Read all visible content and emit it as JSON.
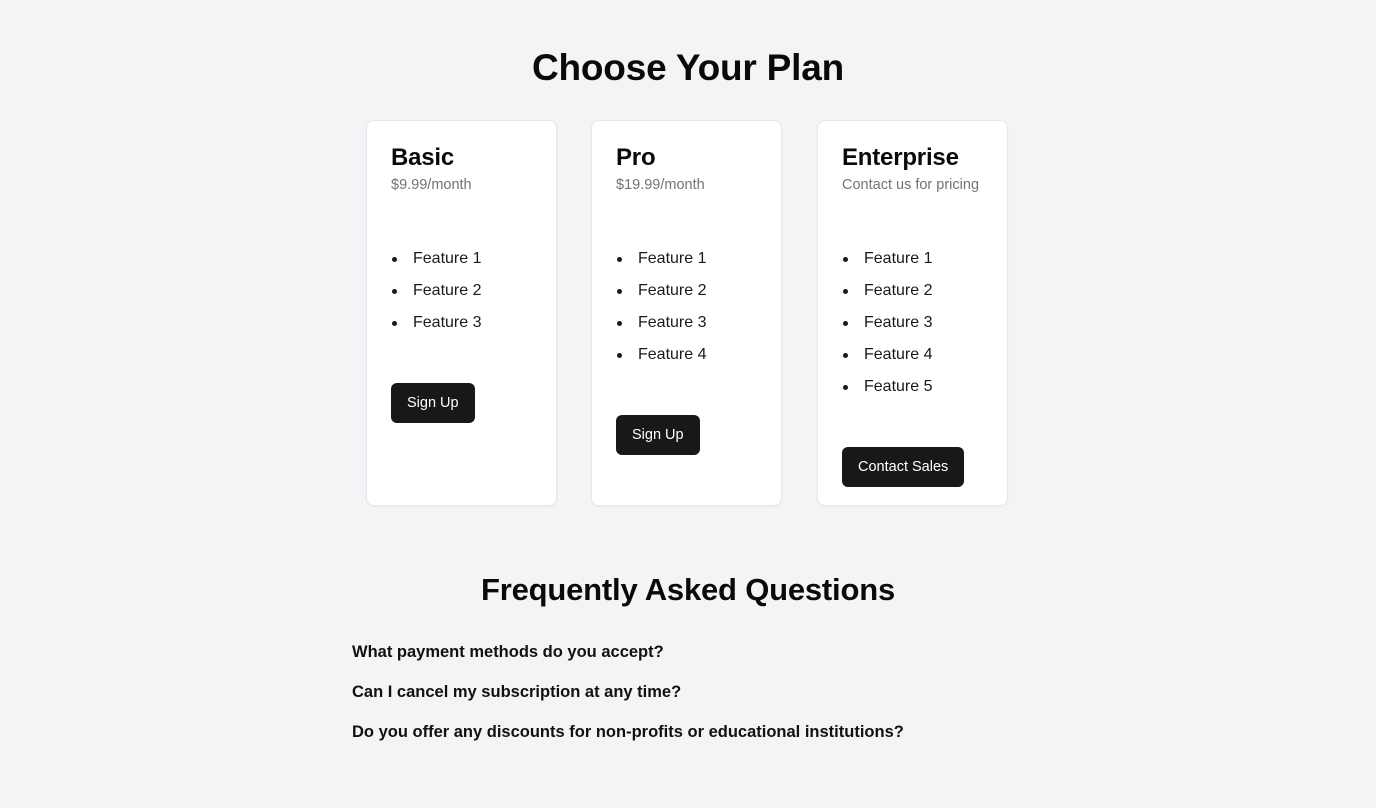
{
  "page": {
    "title": "Choose Your Plan"
  },
  "plans": [
    {
      "name": "Basic",
      "price": "$9.99/month",
      "features": [
        "Feature 1",
        "Feature 2",
        "Feature 3"
      ],
      "cta_label": "Sign Up"
    },
    {
      "name": "Pro",
      "price": "$19.99/month",
      "features": [
        "Feature 1",
        "Feature 2",
        "Feature 3",
        "Feature 4"
      ],
      "cta_label": "Sign Up"
    },
    {
      "name": "Enterprise",
      "price": "Contact us for pricing",
      "features": [
        "Feature 1",
        "Feature 2",
        "Feature 3",
        "Feature 4",
        "Feature 5"
      ],
      "cta_label": "Contact Sales"
    }
  ],
  "faq": {
    "title": "Frequently Asked Questions",
    "questions": [
      "What payment methods do you accept?",
      "Can I cancel my subscription at any time?",
      "Do you offer any discounts for non-profits or educational institutions?"
    ]
  },
  "colors": {
    "background": "#f3f4f6",
    "card": "#ffffff",
    "button": "#18181b",
    "muted_text": "#737373"
  }
}
